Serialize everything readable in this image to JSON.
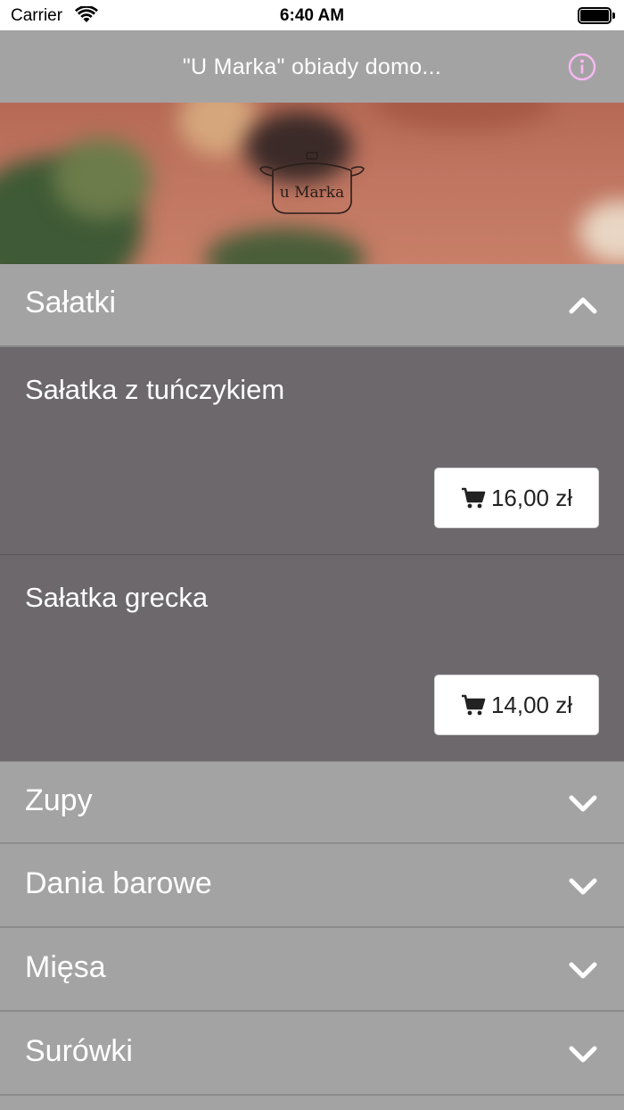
{
  "status_bar": {
    "carrier": "Carrier",
    "time": "6:40 AM"
  },
  "navbar": {
    "title": "\"U Marka\" obiady domo...",
    "info_icon": "info-icon",
    "accent_color": "#f5b8f0"
  },
  "hero": {
    "logo_text": "u Marka"
  },
  "sections": [
    {
      "label": "Sałatki",
      "expanded": true,
      "items": [
        {
          "name": "Sałatka z tuńczykiem",
          "price": "16,00 zł"
        },
        {
          "name": "Sałatka grecka",
          "price": "14,00 zł"
        }
      ]
    },
    {
      "label": "Zupy",
      "expanded": false
    },
    {
      "label": "Dania barowe",
      "expanded": false
    },
    {
      "label": "Mięsa",
      "expanded": false
    },
    {
      "label": "Surówki",
      "expanded": false
    }
  ]
}
